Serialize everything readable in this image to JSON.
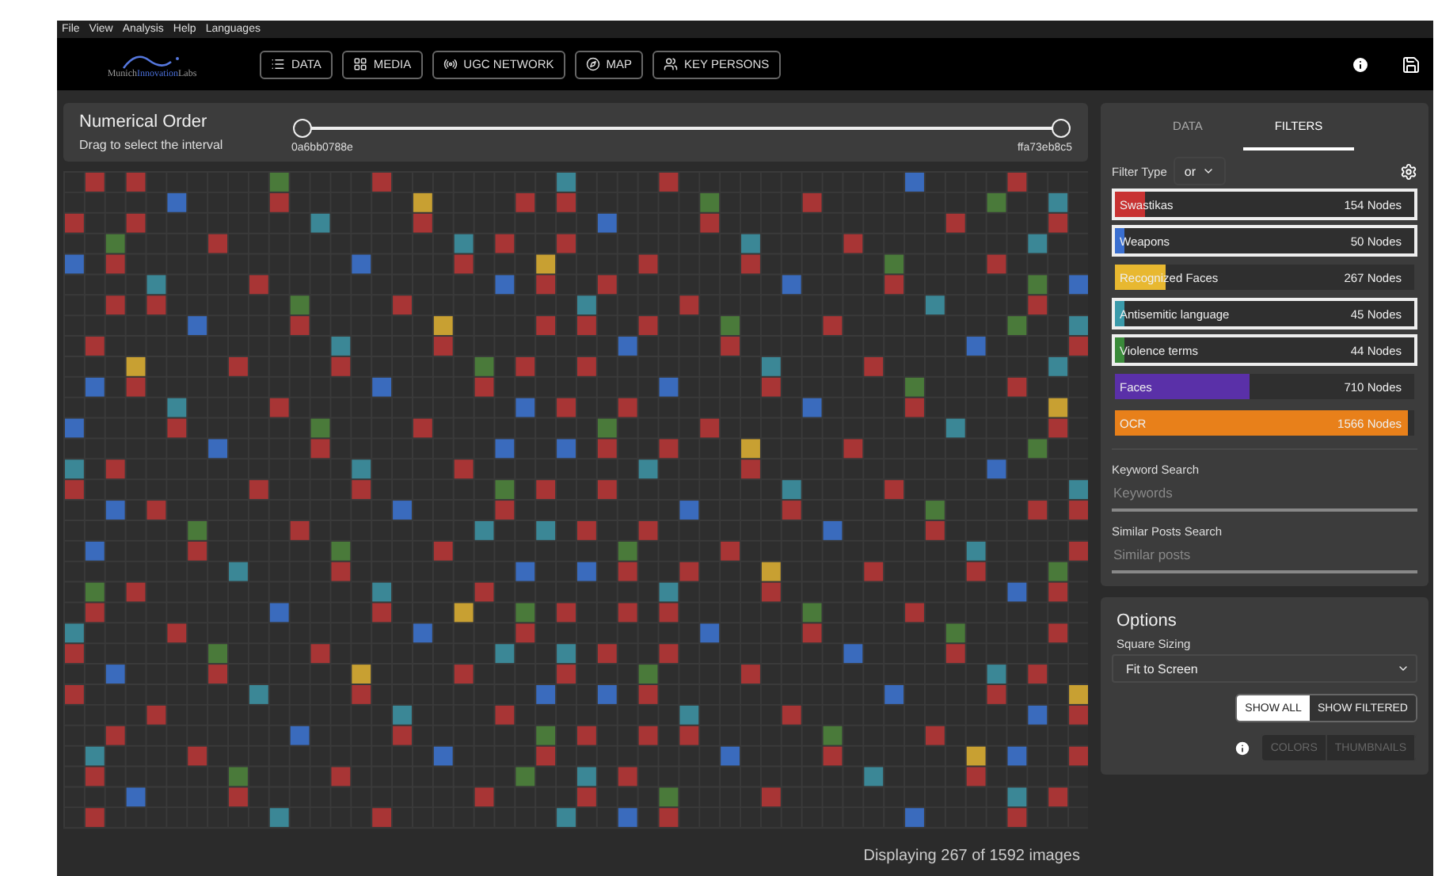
{
  "menu": [
    "File",
    "View",
    "Analysis",
    "Help",
    "Languages"
  ],
  "logo": {
    "parts": [
      {
        "text": "Munich",
        "highlight": false
      },
      {
        "text": "Innovation",
        "highlight": true
      },
      {
        "text": "Labs",
        "highlight": false
      }
    ]
  },
  "nav": [
    {
      "label": "DATA",
      "kind": "list"
    },
    {
      "label": "MEDIA",
      "kind": "grid"
    },
    {
      "label": "UGC NETWORK",
      "kind": "network"
    },
    {
      "label": "MAP",
      "kind": "map"
    },
    {
      "label": "KEY PERSONS",
      "kind": "persons"
    }
  ],
  "order_panel": {
    "title": "Numerical Order",
    "hint": "Drag to select the interval",
    "handles": [
      {
        "label": "0a6bb0788e",
        "level": 0
      },
      {
        "label": "ffa73eb8c5",
        "level": 1
      }
    ]
  },
  "status": "Displaying 267 of 1592 images",
  "side_tabs": [
    {
      "label": "DATA",
      "selected": false
    },
    {
      "label": "FILTERS",
      "selected": true
    }
  ],
  "filter_type": {
    "label": "Filter Type",
    "value": "or"
  },
  "filters": [
    {
      "name": "Swastikas",
      "count": "154 Nodes",
      "level": 0.1,
      "color": "#c83232",
      "selected": true
    },
    {
      "name": "Weapons",
      "count": "50 Nodes",
      "level": 0.03,
      "color": "#3a6fd0",
      "selected": true
    },
    {
      "name": "Recognized Faces",
      "count": "267 Nodes",
      "level": 0.17,
      "color": "#e8b830",
      "selected": false
    },
    {
      "name": "Antisemitic language",
      "count": "45 Nodes",
      "level": 0.03,
      "color": "#3a9aaa",
      "selected": true
    },
    {
      "name": "Violence terms",
      "count": "44 Nodes",
      "level": 0.03,
      "color": "#3a8a3a",
      "selected": true
    },
    {
      "name": "Faces",
      "count": "710 Nodes",
      "level": 0.45,
      "color": "#5a30a8",
      "selected": false
    },
    {
      "name": "OCR",
      "count": "1566 Nodes",
      "level": 0.98,
      "color": "#e8801a",
      "selected": false
    }
  ],
  "keyword_search": {
    "label": "Keyword Search",
    "placeholder": "Keywords"
  },
  "similar_search": {
    "label": "Similar Posts Search",
    "placeholder": "Similar posts"
  },
  "options": {
    "title": "Options",
    "sizing_label": "Square Sizing",
    "sizing_value": "Fit to Screen",
    "show": [
      {
        "label": "SHOW ALL",
        "selected": true
      },
      {
        "label": "SHOW FILTERED",
        "selected": false
      }
    ],
    "view": [
      {
        "label": "COLORS",
        "disabled": true
      },
      {
        "label": "THUMBNAILS",
        "disabled": true
      }
    ]
  }
}
